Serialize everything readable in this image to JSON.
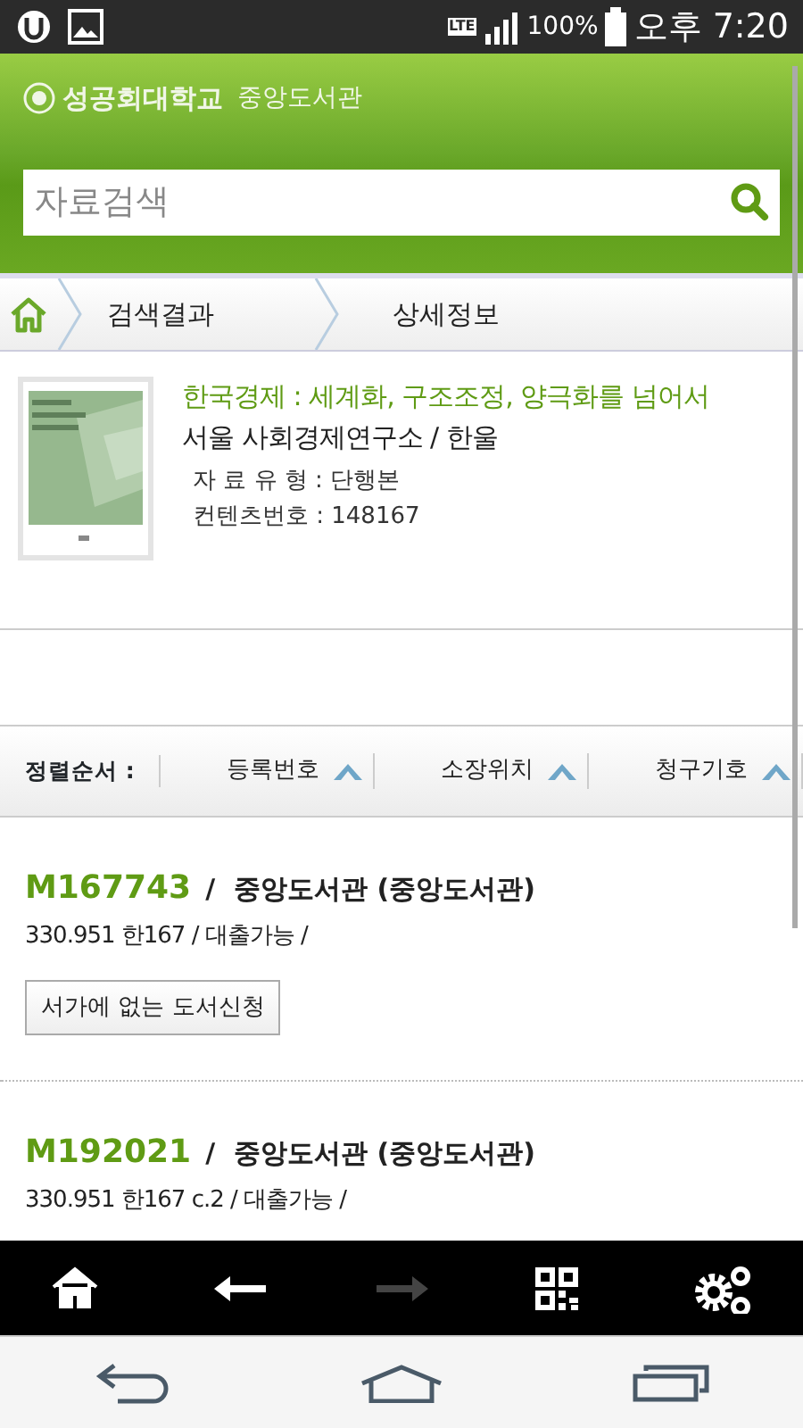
{
  "status_bar": {
    "network": "LTE",
    "battery": "100%",
    "time": "오후 7:20"
  },
  "header": {
    "university": "성공회대학교",
    "library": "중앙도서관",
    "search": {
      "placeholder": "자료검색"
    }
  },
  "breadcrumb": [
    "검색결과",
    "상세정보"
  ],
  "book": {
    "title": "한국경제 : 세계화, 구조조정, 양극화를 넘어서",
    "publisher": "서울 사회경제연구소 / 한울",
    "type": "자 료 유 형 : 단행본",
    "content_no": "컨텐츠번호 : 148167"
  },
  "sort": {
    "label": "정렬순서 :",
    "columns": [
      "등록번호",
      "소장위치",
      "청구기호"
    ]
  },
  "holdings": [
    {
      "reg_no": "M167743",
      "location": "/  중앙도서관 (중앙도서관)",
      "detail": "330.951 한167 / 대출가능 /",
      "button": "서가에 없는 도서신청"
    },
    {
      "reg_no": "M192021",
      "location": "/  중앙도서관 (중앙도서관)",
      "detail": "330.951 한167 c.2 / 대출가능 /"
    }
  ],
  "toolbar": [
    {
      "kind": "home",
      "disabled": false
    },
    {
      "kind": "back",
      "disabled": false
    },
    {
      "kind": "forward",
      "disabled": true
    },
    {
      "kind": "qr",
      "disabled": false
    },
    {
      "kind": "settings",
      "disabled": false
    }
  ]
}
